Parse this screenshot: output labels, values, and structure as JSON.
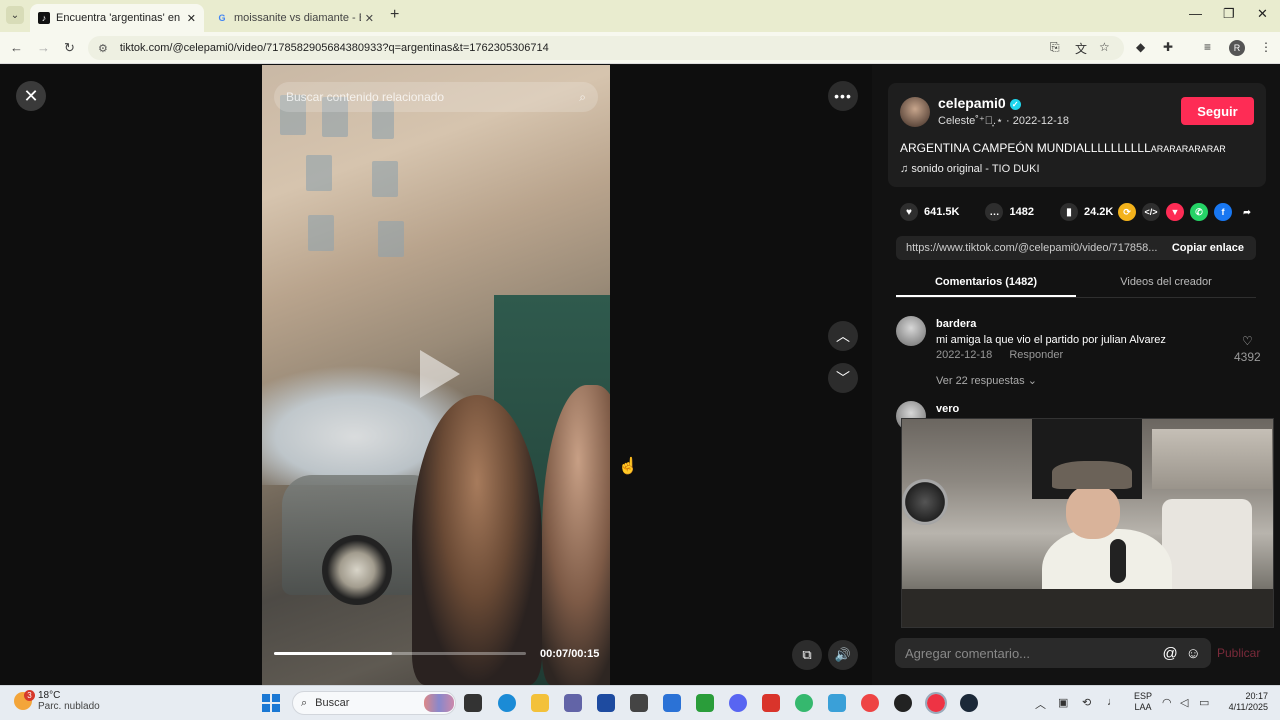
{
  "browser": {
    "tabs": [
      {
        "title": "Encuentra 'argentinas' en TikTok",
        "active": true
      },
      {
        "title": "moissanite vs diamante - Busca",
        "active": false
      }
    ],
    "url": "tiktok.com/@celepami0/video/7178582905684380933?q=argentinas&t=1762305306714",
    "profile_initial": "R"
  },
  "video": {
    "search_placeholder": "Buscar contenido relacionado",
    "timecode": "00:07/00:15",
    "progress": 0.47
  },
  "post": {
    "username": "celepami0",
    "subtitle": "Celeste˚⁺‧͙.⋆ · 2022-12-18",
    "follow_label": "Seguir",
    "description": "ARGENTINA CAMPEÓN MUNDIALLLLLLLLLL",
    "description_tail": "ARARARARARAR",
    "sound": "sonido original - TIO DUKI",
    "likes": "641.5K",
    "comments": "1482",
    "saves": "24.2K",
    "link": "https://www.tiktok.com/@celepami0/video/717858...",
    "copy_label": "Copiar enlace",
    "tab_comments": "Comentarios (1482)",
    "tab_creator_videos": "Videos del creador"
  },
  "comments": [
    {
      "user": "bardera",
      "text": "mi amiga la que vio el partido por julian Alvarez",
      "date": "2022-12-18",
      "reply_label": "Responder",
      "likes": "4392",
      "more": "Ver 22 respuestas"
    },
    {
      "user": "vero"
    }
  ],
  "composer": {
    "placeholder": "Agregar comentario...",
    "publish_label": "Publicar"
  },
  "taskbar": {
    "weather_temp": "18°C",
    "weather_desc": "Parc. nublado",
    "weather_badge": "3",
    "search_label": "Buscar",
    "lang_line1": "ESP",
    "lang_line2": "LAA",
    "time": "20:17",
    "date": "4/11/2025"
  }
}
